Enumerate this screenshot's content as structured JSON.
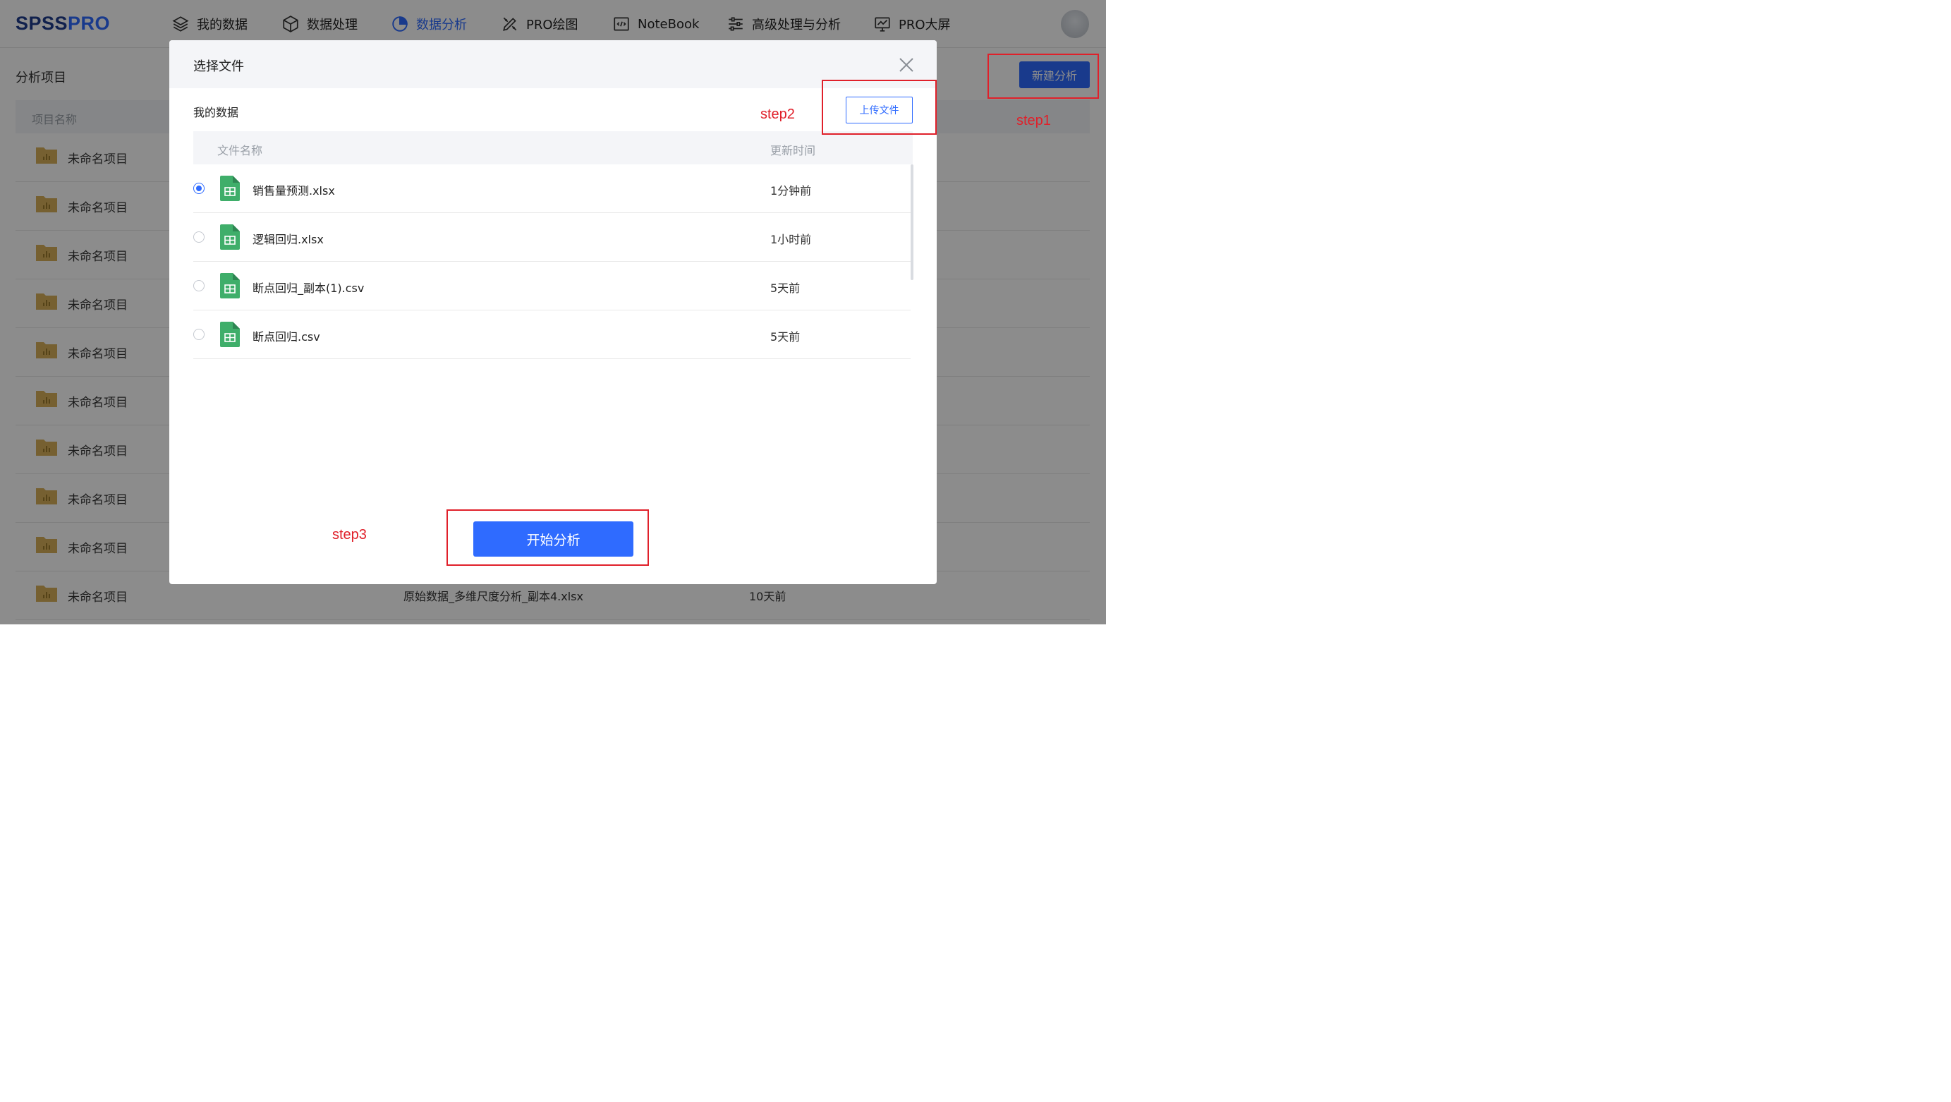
{
  "logo": {
    "part1": "SPSS",
    "part2": "PRO"
  },
  "nav": [
    {
      "label": "我的数据",
      "icon": "layers-icon",
      "active": false
    },
    {
      "label": "数据处理",
      "icon": "cube-icon",
      "active": false
    },
    {
      "label": "数据分析",
      "icon": "pie-chart-icon",
      "active": true
    },
    {
      "label": "PRO绘图",
      "icon": "design-tools-icon",
      "active": false
    },
    {
      "label": "NoteBook",
      "icon": "code-icon",
      "active": false
    },
    {
      "label": "高级处理与分析",
      "icon": "sliders-icon",
      "active": false
    },
    {
      "label": "PRO大屏",
      "icon": "monitor-chart-icon",
      "active": false
    }
  ],
  "page": {
    "title": "分析项目",
    "new_button": "新建分析",
    "table_header": "项目名称",
    "rows": [
      {
        "name": "未命名项目"
      },
      {
        "name": "未命名项目"
      },
      {
        "name": "未命名项目"
      },
      {
        "name": "未命名项目"
      },
      {
        "name": "未命名项目"
      },
      {
        "name": "未命名项目"
      },
      {
        "name": "未命名项目"
      },
      {
        "name": "未命名项目"
      },
      {
        "name": "未命名项目"
      },
      {
        "name": "未命名项目",
        "file": "原始数据_多维尺度分析_副本4.xlsx",
        "time": "10天前"
      }
    ]
  },
  "modal": {
    "title": "选择文件",
    "section_label": "我的数据",
    "upload_button": "上传文件",
    "columns": {
      "name": "文件名称",
      "time": "更新时间"
    },
    "files": [
      {
        "name": "销售量预测.xlsx",
        "time": "1分钟前",
        "selected": true
      },
      {
        "name": "逻辑回归.xlsx",
        "time": "1小时前",
        "selected": false
      },
      {
        "name": "断点回归_副本(1).csv",
        "time": "5天前",
        "selected": false
      },
      {
        "name": "断点回归.csv",
        "time": "5天前",
        "selected": false
      }
    ],
    "start_button": "开始分析"
  },
  "annotations": {
    "step1": "step1",
    "step2": "step2",
    "step3": "step3"
  },
  "colors": {
    "accent": "#2f6bff",
    "annotation": "#e0202a",
    "file_icon": "#3fae6a",
    "folder": "#d8b05a"
  }
}
